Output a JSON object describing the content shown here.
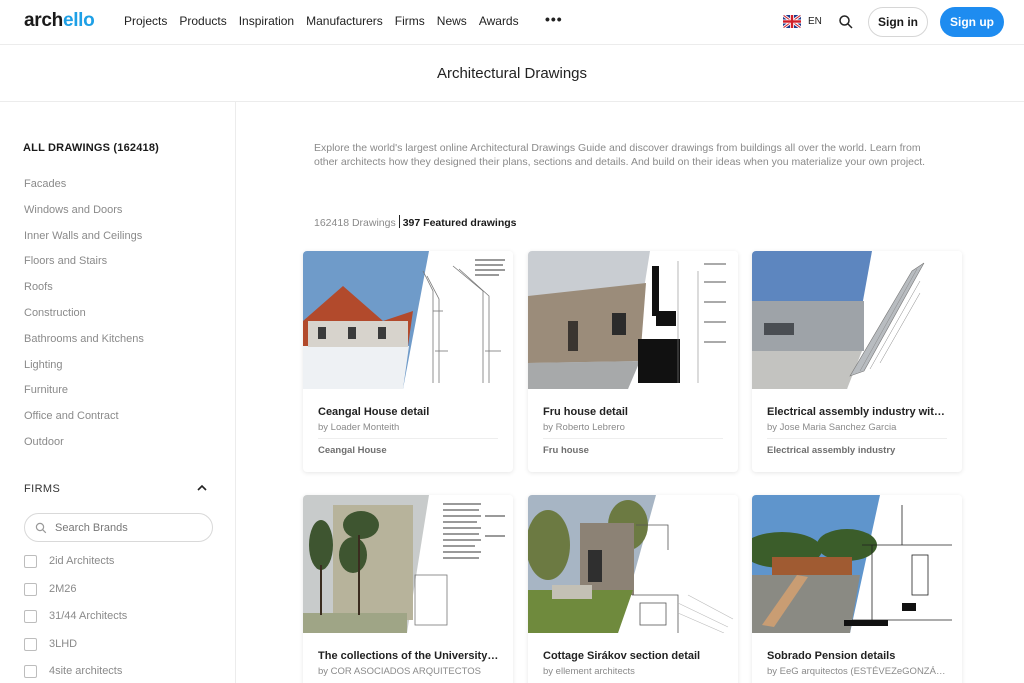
{
  "nav": {
    "logo_a": "arch",
    "logo_b": "ello",
    "menu": [
      "Projects",
      "Products",
      "Inspiration",
      "Manufacturers",
      "Firms",
      "News",
      "Awards"
    ],
    "more": "•••",
    "lang": "EN",
    "signin": "Sign in",
    "signup": "Sign up"
  },
  "page_title": "Architectural Drawings",
  "sidebar": {
    "all_drawings": "ALL DRAWINGS (162418)",
    "categories": [
      "Facades",
      "Windows and Doors",
      "Inner Walls and Ceilings",
      "Floors and Stairs",
      "Roofs",
      "Construction",
      "Bathrooms and Kitchens",
      "Lighting",
      "Furniture",
      "Office and Contract",
      "Outdoor"
    ],
    "firms_heading": "FIRMS",
    "brand_search_placeholder": "Search Brands",
    "firms": [
      "2id Architects",
      "2M26",
      "31/44 Architects",
      "3LHD",
      "4site architects"
    ]
  },
  "main": {
    "intro": "Explore the world's largest online Architectural Drawings Guide and discover drawings from buildings all over the world. Learn from other architects how they designed their plans, sections and details. And build on their ideas when you materialize your own project.",
    "count_drawings": "162418 Drawings",
    "count_featured": "397 Featured drawings",
    "cards": [
      {
        "title": "Ceangal House detail",
        "by": "by Loader Monteith",
        "project": "Ceangal House"
      },
      {
        "title": "Fru house detail",
        "by": "by Roberto Lebrero",
        "project": "Fru house"
      },
      {
        "title": "Electrical assembly industry with steel facade",
        "by": "by Jose Maria Sanchez Garcia",
        "project": "Electrical assembly industry"
      },
      {
        "title": "The collections of the University Library",
        "by": "by COR ASOCIADOS ARQUITECTOS",
        "project": ""
      },
      {
        "title": "Cottage Sirákov section detail",
        "by": "by ellement architects",
        "project": ""
      },
      {
        "title": "Sobrado Pension details",
        "by": "by EeG arquitectos (ESTÉVEZeGONZÁLEZ)",
        "project": ""
      }
    ]
  },
  "colors": {
    "accent": "#1e8cf0",
    "logo_accent": "#1ea0e6",
    "muted_text": "#8a8a8a"
  }
}
